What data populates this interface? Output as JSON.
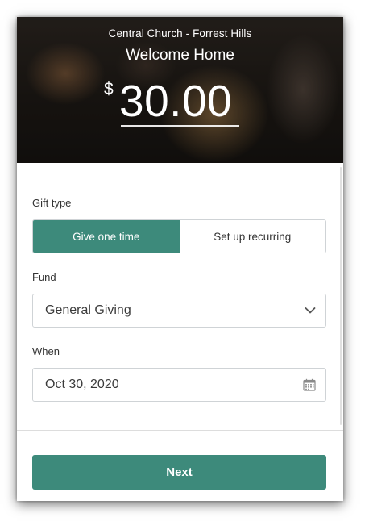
{
  "header": {
    "church_name": "Central Church - Forrest Hills",
    "welcome": "Welcome Home",
    "currency_symbol": "$",
    "amount": "30.00"
  },
  "gift_type": {
    "label": "Gift type",
    "options": [
      "Give one time",
      "Set up recurring"
    ],
    "selected": "Give one time"
  },
  "fund": {
    "label": "Fund",
    "value": "General Giving",
    "icon": "chevron-down-icon"
  },
  "when": {
    "label": "When",
    "value": "Oct 30, 2020",
    "icon": "calendar-icon"
  },
  "actions": {
    "next_label": "Next"
  },
  "colors": {
    "accent": "#3d8a7b",
    "border": "#cfd3d6"
  }
}
